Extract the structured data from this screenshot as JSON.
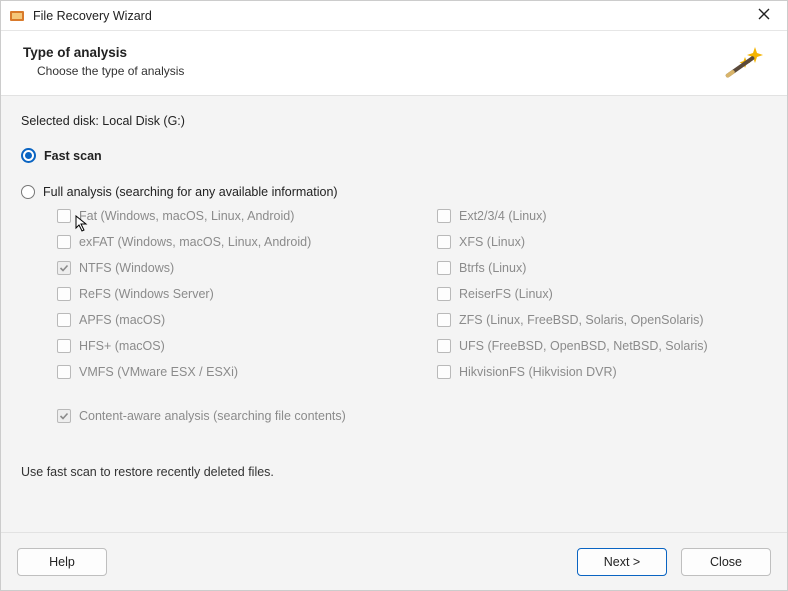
{
  "window": {
    "title": "File Recovery Wizard"
  },
  "header": {
    "title": "Type of analysis",
    "subtitle": "Choose the type of analysis"
  },
  "selected_disk_label": "Selected disk: Local Disk (G:)",
  "scan_modes": {
    "fast": {
      "label": "Fast scan",
      "selected": true
    },
    "full": {
      "label": "Full analysis (searching for any available information)",
      "selected": false
    }
  },
  "filesystems": {
    "left": [
      {
        "label": "Fat (Windows, macOS, Linux, Android)",
        "checked": false
      },
      {
        "label": "exFAT (Windows, macOS, Linux, Android)",
        "checked": false
      },
      {
        "label": "NTFS (Windows)",
        "checked": true
      },
      {
        "label": "ReFS (Windows Server)",
        "checked": false
      },
      {
        "label": "APFS (macOS)",
        "checked": false
      },
      {
        "label": "HFS+ (macOS)",
        "checked": false
      },
      {
        "label": "VMFS (VMware ESX / ESXi)",
        "checked": false
      }
    ],
    "right": [
      {
        "label": "Ext2/3/4 (Linux)",
        "checked": false
      },
      {
        "label": "XFS (Linux)",
        "checked": false
      },
      {
        "label": "Btrfs (Linux)",
        "checked": false
      },
      {
        "label": "ReiserFS (Linux)",
        "checked": false
      },
      {
        "label": "ZFS (Linux, FreeBSD, Solaris, OpenSolaris)",
        "checked": false
      },
      {
        "label": "UFS (FreeBSD, OpenBSD, NetBSD, Solaris)",
        "checked": false
      },
      {
        "label": "HikvisionFS (Hikvision DVR)",
        "checked": false
      }
    ]
  },
  "content_aware": {
    "label": "Content-aware analysis (searching file contents)",
    "checked": true
  },
  "hint": "Use fast scan to restore recently deleted files.",
  "buttons": {
    "help": "Help",
    "next": "Next >",
    "close": "Close"
  }
}
